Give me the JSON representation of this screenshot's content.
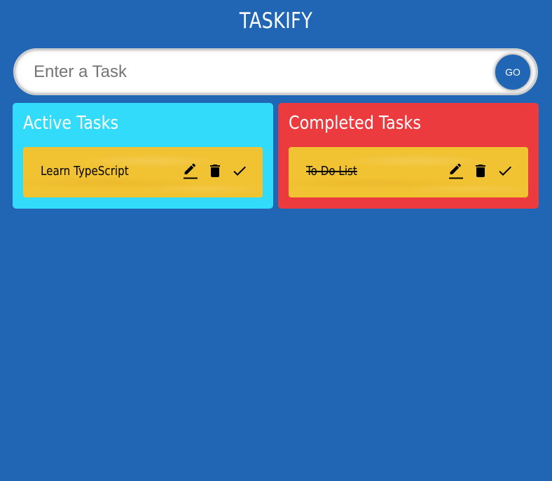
{
  "app": {
    "title": "TASKIFY"
  },
  "form": {
    "input_placeholder": "Enter a Task",
    "input_value": "",
    "submit_label": "GO"
  },
  "columns": {
    "active": {
      "heading": "Active Tasks",
      "background": "#32dbf9",
      "tasks": [
        {
          "text": "Learn TypeScript",
          "completed": false
        }
      ]
    },
    "completed": {
      "heading": "Completed Tasks",
      "background": "#eb3b3f",
      "tasks": [
        {
          "text": "To Do List",
          "completed": true
        }
      ]
    }
  },
  "task_actions": {
    "edit_icon": "edit-icon",
    "delete_icon": "trash-icon",
    "done_icon": "check-icon"
  },
  "colors": {
    "page_background": "#2166b5",
    "card_background": "#f1c232",
    "accent": "#2166b5"
  }
}
